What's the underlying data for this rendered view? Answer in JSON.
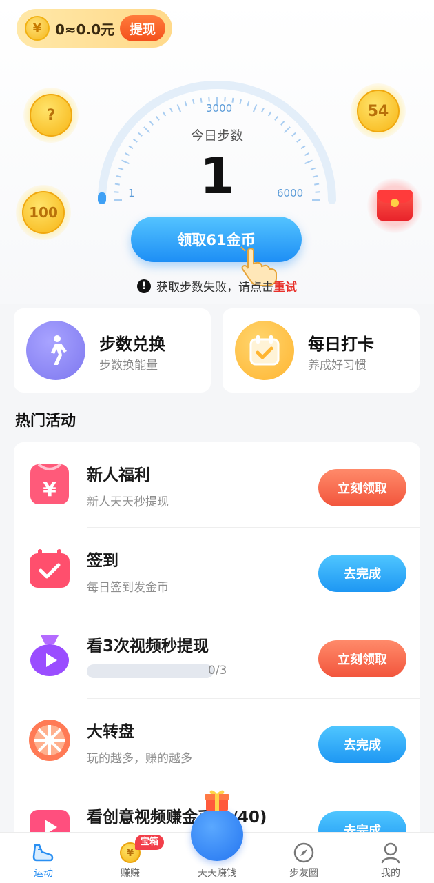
{
  "wallet": {
    "coin_symbol": "¥",
    "amount": "0≈0.0元",
    "withdraw_label": "提现"
  },
  "floating_coins": {
    "mystery": "?",
    "coin_54": "54",
    "coin_100": "100"
  },
  "gauge": {
    "label": "今日步数",
    "steps": "1",
    "tick_min": "1",
    "tick_mid": "3000",
    "tick_max": "6000",
    "progress": 0.0002
  },
  "claim": {
    "label": "领取61金币"
  },
  "error": {
    "icon": "!",
    "message": "获取步数失败，请点击",
    "retry": "重试"
  },
  "cards": [
    {
      "title": "步数兑换",
      "subtitle": "步数换能量",
      "icon": "walking-person-icon",
      "color": "#8a86f5"
    },
    {
      "title": "每日打卡",
      "subtitle": "养成好习惯",
      "icon": "calendar-check-icon",
      "color": "#ffc04a"
    }
  ],
  "section_title": "热门活动",
  "activities": [
    {
      "title": "新人福利",
      "subtitle": "新人天天秒提现",
      "action": "立刻领取",
      "style": "orange",
      "icon": "yen-gift-icon"
    },
    {
      "title": "签到",
      "subtitle": "每日签到发金币",
      "action": "去完成",
      "style": "blue",
      "icon": "calendar-check-icon"
    },
    {
      "title": "看3次视频秒提现",
      "subtitle": "",
      "action": "立刻领取",
      "style": "orange",
      "icon": "play-bag-icon",
      "progress_text": "0/3",
      "progress": 0
    },
    {
      "title": "大转盘",
      "subtitle": "玩的越多，赚的越多",
      "action": "去完成",
      "style": "blue",
      "icon": "wheel-icon"
    },
    {
      "title": "看创意视频赚金币(0/40)",
      "subtitle": "",
      "action": "去完成",
      "style": "blue",
      "icon": "video-icon"
    }
  ],
  "nav": [
    {
      "label": "运动",
      "icon": "shoe-icon",
      "active": true
    },
    {
      "label": "赚赚",
      "icon": "coin-icon",
      "badge": "宝箱"
    },
    {
      "label": "天天赚钱",
      "icon": "center-orb-icon"
    },
    {
      "label": "步友圈",
      "icon": "compass-icon"
    },
    {
      "label": "我的",
      "icon": "person-icon"
    }
  ],
  "colors": {
    "accent_blue": "#1e97f3",
    "accent_orange": "#f2553c",
    "retry_red": "#e8302a",
    "coin_gold": "#f7b515"
  }
}
